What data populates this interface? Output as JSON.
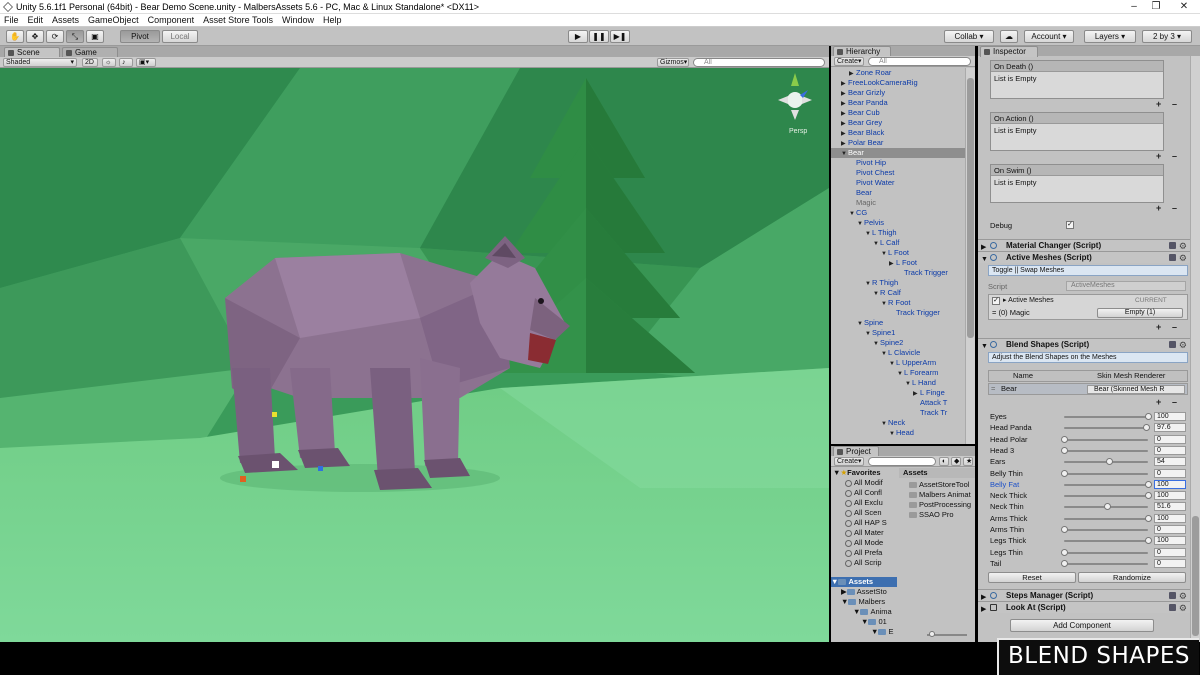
{
  "window": {
    "title": "Unity 5.6.1f1 Personal (64bit) - Bear Demo Scene.unity - MalbersAssets 5.6 - PC, Mac & Linux Standalone* <DX11>"
  },
  "menu": [
    "File",
    "Edit",
    "Assets",
    "GameObject",
    "Component",
    "Asset Store Tools",
    "Window",
    "Help"
  ],
  "toolbar": {
    "pivot": "Pivot",
    "local": "Local",
    "collab": "Collab",
    "account": "Account",
    "layers": "Layers",
    "layout": "2 by 3"
  },
  "scene": {
    "tab_scene": "Scene",
    "tab_game": "Game",
    "shading": "Shaded",
    "mode_2d": "2D",
    "gizmos": "Gizmos",
    "search_placeholder": "All",
    "persp": "Persp"
  },
  "hierarchy": {
    "tab": "Hierarchy",
    "create": "Create",
    "search_placeholder": "All",
    "rows": [
      {
        "label": "Zone Roar",
        "indent": 2,
        "arrow": "▶"
      },
      {
        "label": "FreeLookCameraRig",
        "indent": 1,
        "arrow": "▶"
      },
      {
        "label": "Bear Grizly",
        "indent": 1,
        "arrow": "▶"
      },
      {
        "label": "Bear Panda",
        "indent": 1,
        "arrow": "▶"
      },
      {
        "label": "Bear Cub",
        "indent": 1,
        "arrow": "▶"
      },
      {
        "label": "Bear Grey",
        "indent": 1,
        "arrow": "▶"
      },
      {
        "label": "Bear Black",
        "indent": 1,
        "arrow": "▶"
      },
      {
        "label": "Polar Bear",
        "indent": 1,
        "arrow": "▶"
      },
      {
        "label": "Bear",
        "indent": 1,
        "arrow": "▼",
        "selected": true
      },
      {
        "label": "Pivot Hip",
        "indent": 2,
        "arrow": ""
      },
      {
        "label": "Pivot Chest",
        "indent": 2,
        "arrow": ""
      },
      {
        "label": "Pivot Water",
        "indent": 2,
        "arrow": ""
      },
      {
        "label": "Bear",
        "indent": 2,
        "arrow": ""
      },
      {
        "label": "Magic",
        "indent": 2,
        "arrow": "",
        "gray": true
      },
      {
        "label": "CG",
        "indent": 2,
        "arrow": "▼"
      },
      {
        "label": "Pelvis",
        "indent": 3,
        "arrow": "▼"
      },
      {
        "label": "L Thigh",
        "indent": 4,
        "arrow": "▼"
      },
      {
        "label": "L Calf",
        "indent": 5,
        "arrow": "▼"
      },
      {
        "label": "L Foot",
        "indent": 6,
        "arrow": "▼"
      },
      {
        "label": "L Foot",
        "indent": 7,
        "arrow": "▶"
      },
      {
        "label": "Track Trigger",
        "indent": 8,
        "arrow": ""
      },
      {
        "label": "R Thigh",
        "indent": 4,
        "arrow": "▼"
      },
      {
        "label": "R Calf",
        "indent": 5,
        "arrow": "▼"
      },
      {
        "label": "R Foot",
        "indent": 6,
        "arrow": "▼"
      },
      {
        "label": "Track Trigger",
        "indent": 7,
        "arrow": ""
      },
      {
        "label": "Spine",
        "indent": 3,
        "arrow": "▼"
      },
      {
        "label": "Spine1",
        "indent": 4,
        "arrow": "▼"
      },
      {
        "label": "Spine2",
        "indent": 5,
        "arrow": "▼"
      },
      {
        "label": "L Clavicle",
        "indent": 6,
        "arrow": "▼"
      },
      {
        "label": "L UpperArm",
        "indent": 7,
        "arrow": "▼"
      },
      {
        "label": "L Forearm",
        "indent": 8,
        "arrow": "▼"
      },
      {
        "label": "L Hand",
        "indent": 9,
        "arrow": "▼"
      },
      {
        "label": "L Finge",
        "indent": 10,
        "arrow": "▶"
      },
      {
        "label": "Attack T",
        "indent": 10,
        "arrow": ""
      },
      {
        "label": "Track Tr",
        "indent": 10,
        "arrow": ""
      },
      {
        "label": "Neck",
        "indent": 6,
        "arrow": "▼"
      },
      {
        "label": "Head",
        "indent": 7,
        "arrow": "▼"
      }
    ]
  },
  "project": {
    "tab": "Project",
    "create": "Create",
    "favorites_label": "Favorites",
    "favorites": [
      "All Modif",
      "All Confl",
      "All Exclu",
      "All Scen",
      "All HAP S",
      "All Mater",
      "All Mode",
      "All Prefa",
      "All Scrip"
    ],
    "assets_label": "Assets",
    "assets_tree": [
      "AssetSto",
      "Malbers",
      "Anima",
      "01",
      "E"
    ],
    "assets_header": "Assets",
    "asset_folders": [
      "AssetStoreTool",
      "Malbers Animat",
      "PostProcessing",
      "SSAO Pro"
    ]
  },
  "inspector": {
    "tab": "Inspector",
    "events": [
      {
        "title": "On Death ()",
        "body": "List is Empty"
      },
      {
        "title": "On Action ()",
        "body": "List is Empty"
      },
      {
        "title": "On Swim ()",
        "body": "List is Empty"
      }
    ],
    "debug_label": "Debug",
    "material_changer": "Material Changer (Script)",
    "active_meshes": "Active Meshes (Script)",
    "active_meshes_info": "Toggle || Swap Meshes",
    "script_label": "Script",
    "script_value": "ActiveMeshes",
    "active_meshes_field": "Active Meshes",
    "current_label": "CURRENT",
    "magic_row": "(0)  Magic",
    "magic_value": "Empty (1)",
    "blend_shapes": "Blend Shapes (Script)",
    "blend_info": "Adjust the Blend Shapes on the Meshes",
    "col_name": "Name",
    "col_renderer": "Skin Mesh Renderer",
    "mesh_name": "Bear",
    "mesh_renderer": "Bear (Skinned Mesh R",
    "shapes": [
      {
        "name": "Eyes",
        "value": "100",
        "level": 1.0
      },
      {
        "name": "Head Panda",
        "value": "97.6",
        "level": 0.976
      },
      {
        "name": "Head Polar",
        "value": "0",
        "level": 0
      },
      {
        "name": "Head 3",
        "value": "0",
        "level": 0
      },
      {
        "name": "Ears",
        "value": "54",
        "level": 0.54
      },
      {
        "name": "Belly Thin",
        "value": "0",
        "level": 0
      },
      {
        "name": "Belly Fat",
        "value": "100",
        "level": 1.0,
        "active": true
      },
      {
        "name": "Neck Thick",
        "value": "100",
        "level": 1.0
      },
      {
        "name": "Neck Thin",
        "value": "51.6",
        "level": 0.516
      },
      {
        "name": "Arms Thick",
        "value": "100",
        "level": 1.0
      },
      {
        "name": "Arms Thin",
        "value": "0",
        "level": 0
      },
      {
        "name": "Legs Thick",
        "value": "100",
        "level": 1.0
      },
      {
        "name": "Legs Thin",
        "value": "0",
        "level": 0
      },
      {
        "name": "Tail",
        "value": "0",
        "level": 0
      }
    ],
    "reset": "Reset",
    "randomize": "Randomize",
    "steps_manager": "Steps Manager (Script)",
    "look_at": "Look At (Script)",
    "add_component": "Add Component"
  },
  "watermark": "BLEND SHAPES"
}
